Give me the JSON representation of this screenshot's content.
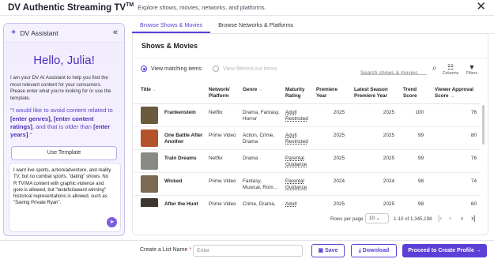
{
  "app": {
    "title": "DV Authentic Streaming TV",
    "trademark": "TM",
    "subtitle": "Explore shows, movies, networks, and platforms.",
    "close_glyph": "✕"
  },
  "assistant": {
    "title": "DV Assistant",
    "collapse_glyph": "«",
    "greeting": "Hello, Julia!",
    "intro": "I am your DV AI Assistant to help you find the most relevant content for your consumers. Please enter what you're looking for or use the template.",
    "template_parts": [
      "\"I would like to avoid content related to ",
      "[enter genres], [enter content ratings]",
      ", and that is older than ",
      "[enter years]",
      ".\""
    ],
    "use_template_label": "Use Template",
    "prompt_text": "I want live sports, action/adventure, and reality TV, but no combat sports, \"dating\" shows. No R TV/MA content with graphic violence and gore is allowed, but \"tasteful/award winning\" historical representations is allowed, such as \"Saving Private Ryan\".",
    "send_glyph": "➤"
  },
  "tabs": [
    {
      "label": "Browse Shows & Movies",
      "active": true
    },
    {
      "label": "Browse Networks & Platforms",
      "active": false
    }
  ],
  "main": {
    "section_title": "Shows & Movies",
    "radio_matching": "View matching items",
    "radio_filtered": "View filtered out items",
    "search_placeholder": "Search shows & movies",
    "columns_label": "Columns",
    "filters_label": "Filters"
  },
  "table": {
    "headers": {
      "title": "Title",
      "network": "Network/ Platform",
      "genre": "Genre",
      "maturity": "Maturity Rating",
      "premiere": "Premiere Year",
      "latest": "Latest Season Premiere Year",
      "trend": "Trend Score",
      "approval": "Viewer Approval Score"
    },
    "rows": [
      {
        "title": "Frankenstein",
        "network": "Netflix",
        "genre": "Drama, Fantasy, Horror",
        "rating": "Adult Restricted",
        "premiere": "2025",
        "latest": "2025",
        "trend": "100",
        "approval": "76",
        "thumb_color": "#6b5a3e"
      },
      {
        "title": "One Battle After Another",
        "network": "Prime Video",
        "genre": "Action, Crime, Drama",
        "rating": "Adult Restricted",
        "premiere": "2025",
        "latest": "2025",
        "trend": "99",
        "approval": "80",
        "thumb_color": "#b4532a"
      },
      {
        "title": "Train Dreams",
        "network": "Netflix",
        "genre": "Drama",
        "rating": "Parental Guidance",
        "premiere": "2025",
        "latest": "2025",
        "trend": "99",
        "approval": "76",
        "thumb_color": "#8a8a84"
      },
      {
        "title": "Wicked",
        "network": "Prime Video",
        "genre": "Fantasy, Musical, Rom...",
        "rating": "Parental Guidance",
        "premiere": "2024",
        "latest": "2024",
        "trend": "98",
        "approval": "74",
        "thumb_color": "#7a6a4f"
      },
      {
        "title": "After the Hunt",
        "network": "Prime Video",
        "genre": "Crime, Drama,",
        "rating": "Adult",
        "premiere": "2025",
        "latest": "2025",
        "trend": "98",
        "approval": "60",
        "thumb_color": "#3d3530"
      }
    ]
  },
  "pager": {
    "rows_per_page_label": "Rows per page",
    "rows_per_page_value": "10",
    "range": "1-10 of 1,345,198"
  },
  "bottom": {
    "list_name_label": "Create a List Name",
    "list_name_required": "*",
    "list_name_placeholder": "Enter",
    "save_label": "Save",
    "download_label": "Download",
    "proceed_label": "Proceed to Create Profile"
  },
  "colors": {
    "accent": "#5b3fd6",
    "assistant_bg": "#f1ecfd"
  }
}
